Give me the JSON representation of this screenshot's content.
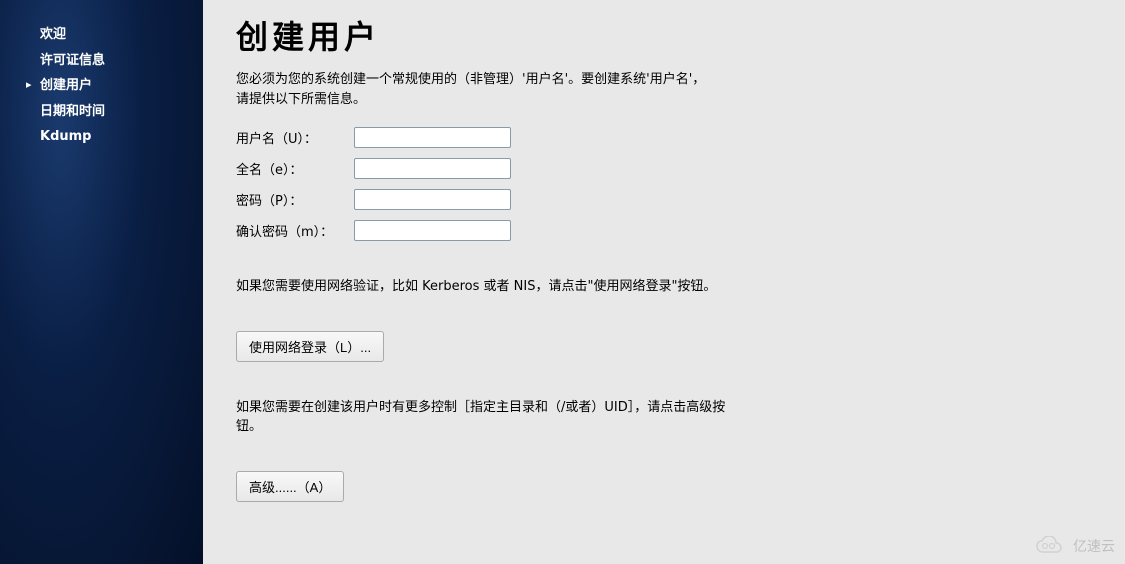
{
  "sidebar": {
    "items": [
      {
        "label": "欢迎"
      },
      {
        "label": "许可证信息"
      },
      {
        "label": "创建用户"
      },
      {
        "label": "日期和时间"
      },
      {
        "label": "Kdump"
      }
    ]
  },
  "main": {
    "title": "创建用户",
    "description": "您必须为您的系统创建一个常规使用的（非管理）'用户名'。要创建系统'用户名'，请提供以下所需信息。",
    "form": {
      "username_label": "用户名（U）：",
      "fullname_label": "全名（e）：",
      "password_label": "密码（P）：",
      "confirm_label": "确认密码（m）：",
      "username_value": "",
      "fullname_value": "",
      "password_value": "",
      "confirm_value": ""
    },
    "network_info": "如果您需要使用网络验证，比如 Kerberos 或者 NIS，请点击\"使用网络登录\"按钮。",
    "network_button": "使用网络登录（L）...",
    "advanced_info": "如果您需要在创建该用户时有更多控制［指定主目录和（/或者）UID］，请点击高级按钮。",
    "advanced_button": "高级......（A）"
  },
  "watermark": {
    "text": "亿速云"
  }
}
